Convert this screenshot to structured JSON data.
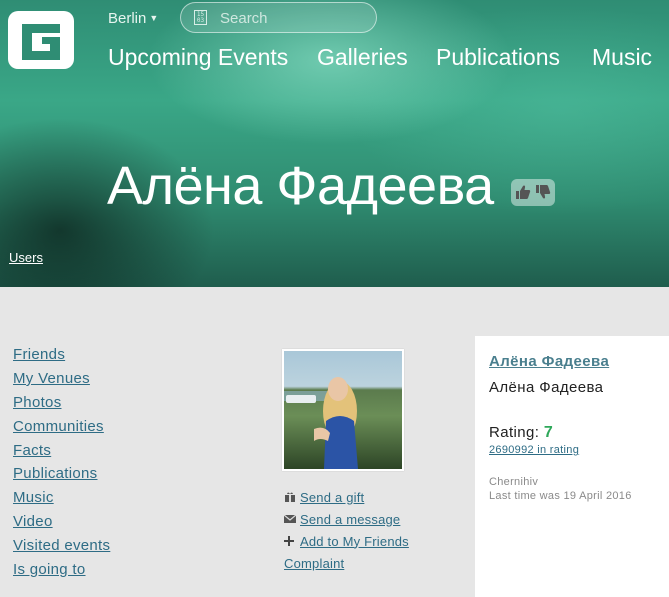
{
  "header": {
    "city": "Berlin",
    "search_placeholder": "Search",
    "calendar_icon_text": "15 03",
    "nav": [
      "Upcoming Events",
      "Galleries",
      "Publications",
      "Music"
    ]
  },
  "profile": {
    "title": "Алёна Фадеева",
    "breadcrumb": "Users"
  },
  "sidebar": {
    "items": [
      "Friends",
      "My Venues",
      "Photos",
      "Communities",
      "Facts",
      "Publications",
      "Music",
      "Video",
      "Visited events",
      "Is going to"
    ]
  },
  "actions": {
    "send_gift": "Send a gift",
    "send_message": "Send a message",
    "add_friend": "Add to My Friends",
    "complaint": "Complaint"
  },
  "card": {
    "name_link": "Алёна Фадеева",
    "name": "Алёна Фадеева",
    "rating_label": "Rating:",
    "rating_value": "7",
    "rank_text": "2690992 in rating",
    "city": "Chernihiv",
    "last_seen": "Last time was 19 April 2016"
  },
  "colors": {
    "link": "#2e6c85",
    "rating_value": "#2fa85a",
    "hero": "#3aa787",
    "page_bg": "#e6e6e6"
  },
  "icons": [
    "site-logo-icon",
    "chevron-down-icon",
    "calendar-icon",
    "thumbs-up-icon",
    "thumbs-down-icon",
    "gift-icon",
    "envelope-icon",
    "plus-icon"
  ]
}
